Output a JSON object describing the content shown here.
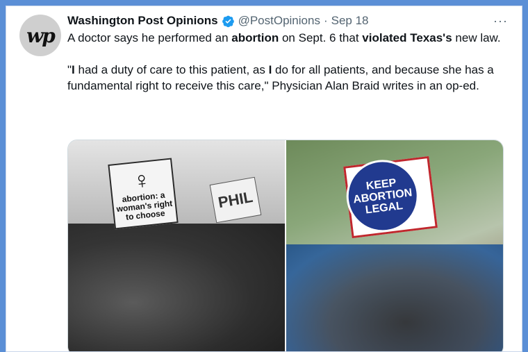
{
  "tweet": {
    "author_name": "Washington Post Opinions",
    "handle": "@PostOpinions",
    "separator": "·",
    "date": "Sep 18",
    "avatar_text": "wp",
    "more_label": "···",
    "paragraph1": {
      "t1": "A doctor says he performed an ",
      "b1": "abortion",
      "t2": " on Sept. 6 that ",
      "b2": "violated Texas's",
      "t3": " new law."
    },
    "paragraph2": {
      "t1": "\"",
      "b1": "I",
      "t2": " had a duty of care to this patient, as ",
      "b2": "I",
      "t3": " do for all patients, and because she has a fundamental right to receive this care,\" Physician Alan Braid writes in an op-ed."
    }
  },
  "media": {
    "left_sign_symbol": "♀",
    "left_sign_text": "abortion: a woman's right to choose",
    "phil_sign_text": "PHIL",
    "right_sign_text": "KEEP ABORTION LEGAL"
  },
  "colors": {
    "background": "#5b8fd6",
    "verified": "#1d9bf0",
    "secondary_text": "#536471"
  }
}
